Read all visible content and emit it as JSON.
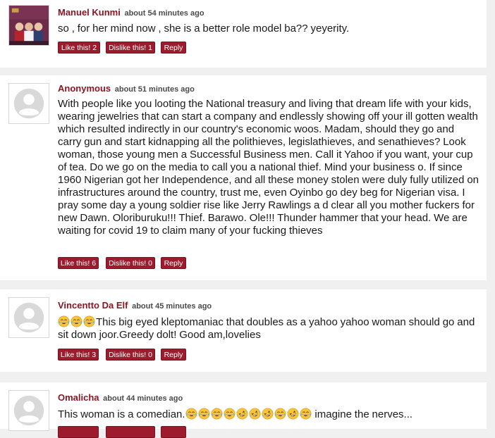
{
  "comments": [
    {
      "author": "Manuel Kunmi",
      "time": "about 54 minutes ago",
      "text": "so , for her mind now , she is a better role model ba?? yeyerity.",
      "like_label": "Like this! 2",
      "dislike_label": "Dislike this! 1",
      "reply_label": "Reply",
      "avatar": "team-photo"
    },
    {
      "author": "Anonymous",
      "time": "about 51 minutes ago",
      "text": "With people like you looting the National treasury and living that dream life with your kids, wearing jewelries that can start a company and endlessly showing off your ill gotten wealth which resulted indirectly in our country's economic woos. Madam, should they go and carry gun and start kidnapping all the polithieves, legislathieves, and senathieves? Look woman, those young men a Successful Business men. Call it Yahoo if you want, your cup of tea. Do we go on the media to call you a national thief. Mind your business o. If since 1960 Nigerian got her Independence, and all these money stolen were duly fully utilized on infrastructures around the country, trust me, even Oyinbo go dey beg for Nigerian visa. I pray some day a young soldier rise like Jerry Rawlings a d clear all you mother fuckers for new Dawn. Oloriburuku!!! Thief. Barawo. Ole!!! Thunder hammer that your head. We are waiting for covid 19 to claim many of your fucking thieves",
      "like_label": "Like this! 6",
      "dislike_label": "Dislike this! 0",
      "reply_label": "Reply",
      "avatar": "default-avatar"
    },
    {
      "author": "Vincentto Da Elf",
      "time": "about 45 minutes ago",
      "text_main": "This big eyed kleptomaniac that doubles as a yahoo yahoo woman should go and sit down joor.Greedy dolt! Good am,lovelies",
      "like_label": "Like this! 3",
      "dislike_label": "Dislike this! 0",
      "reply_label": "Reply",
      "avatar": "default-avatar",
      "emojis": [
        "joy",
        "joy",
        "joy"
      ]
    },
    {
      "author": "Omalicha",
      "time": "about 44 minutes ago",
      "text_before": "This woman is a comedian.",
      "text_after": " imagine the nerves...",
      "emojis": [
        "joy",
        "joy",
        "joy",
        "joy",
        "rofl",
        "rofl",
        "rofl",
        "joy",
        "rofl",
        "joy"
      ],
      "avatar": "default-avatar"
    }
  ],
  "colors": {
    "author": "#8a1523",
    "button_bg": "#9c1c2e",
    "page_bg": "#f0f0f0",
    "card_bg": "#ffffff"
  }
}
